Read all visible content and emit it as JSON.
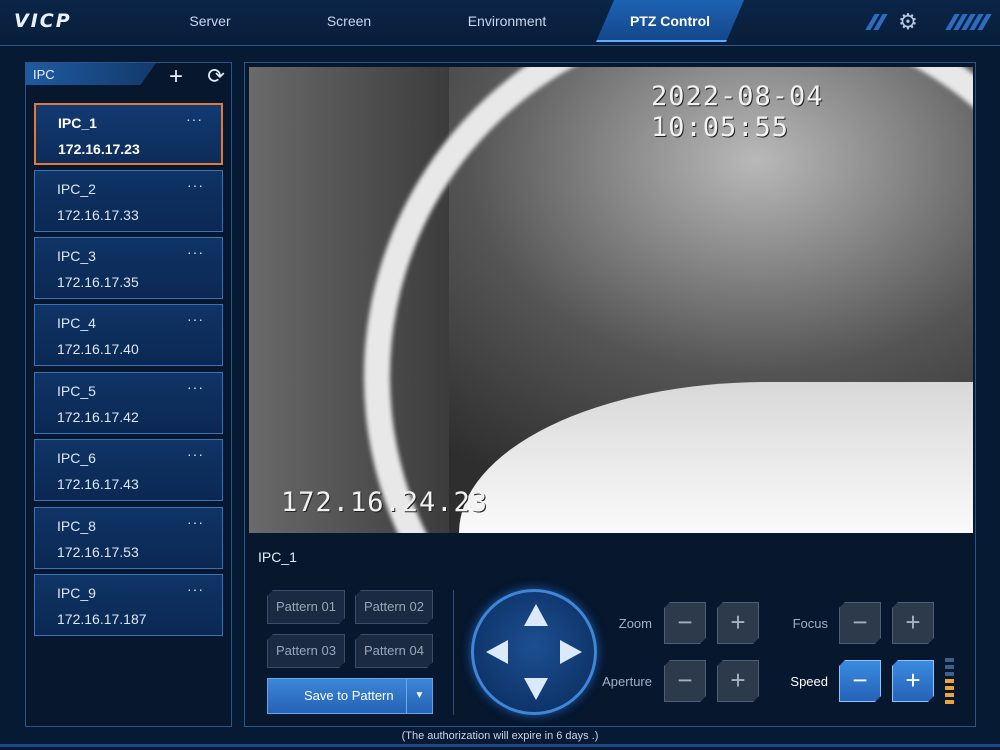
{
  "app": {
    "logo": "VICP"
  },
  "nav": {
    "tabs": [
      {
        "label": "Server"
      },
      {
        "label": "Screen"
      },
      {
        "label": "Environment"
      },
      {
        "label": "PTZ Control",
        "active": true
      }
    ],
    "settings_icon": "gear-icon"
  },
  "sidebar": {
    "title": "IPC",
    "add_icon": "plus-icon",
    "refresh_icon": "refresh-icon",
    "more_label": "···",
    "items": [
      {
        "name": "IPC_1",
        "ip": "172.16.17.23",
        "selected": true
      },
      {
        "name": "IPC_2",
        "ip": "172.16.17.33"
      },
      {
        "name": "IPC_3",
        "ip": "172.16.17.35"
      },
      {
        "name": "IPC_4",
        "ip": "172.16.17.40"
      },
      {
        "name": "IPC_5",
        "ip": "172.16.17.42"
      },
      {
        "name": "IPC_6",
        "ip": "172.16.17.43"
      },
      {
        "name": "IPC_8",
        "ip": "172.16.17.53"
      },
      {
        "name": "IPC_9",
        "ip": "172.16.17.187"
      }
    ]
  },
  "video": {
    "timestamp": "2022-08-04 10:05:55",
    "overlay_ip": "172.16.24.23"
  },
  "camera_label": "IPC_1",
  "patterns": {
    "buttons": [
      "Pattern 01",
      "Pattern 02",
      "Pattern 03",
      "Pattern 04"
    ],
    "save_label": "Save to Pattern",
    "caret": "▼"
  },
  "controls": {
    "zoom_label": "Zoom",
    "focus_label": "Focus",
    "aperture_label": "Aperture",
    "speed_label": "Speed",
    "minus": "−",
    "plus": "+",
    "speed_level": {
      "on": 4,
      "total": 7
    },
    "accent_color": "#2f7ad0",
    "level_color": "#f0a23a"
  },
  "footer": {
    "message": "(The authorization will expire in 6 days .)"
  }
}
